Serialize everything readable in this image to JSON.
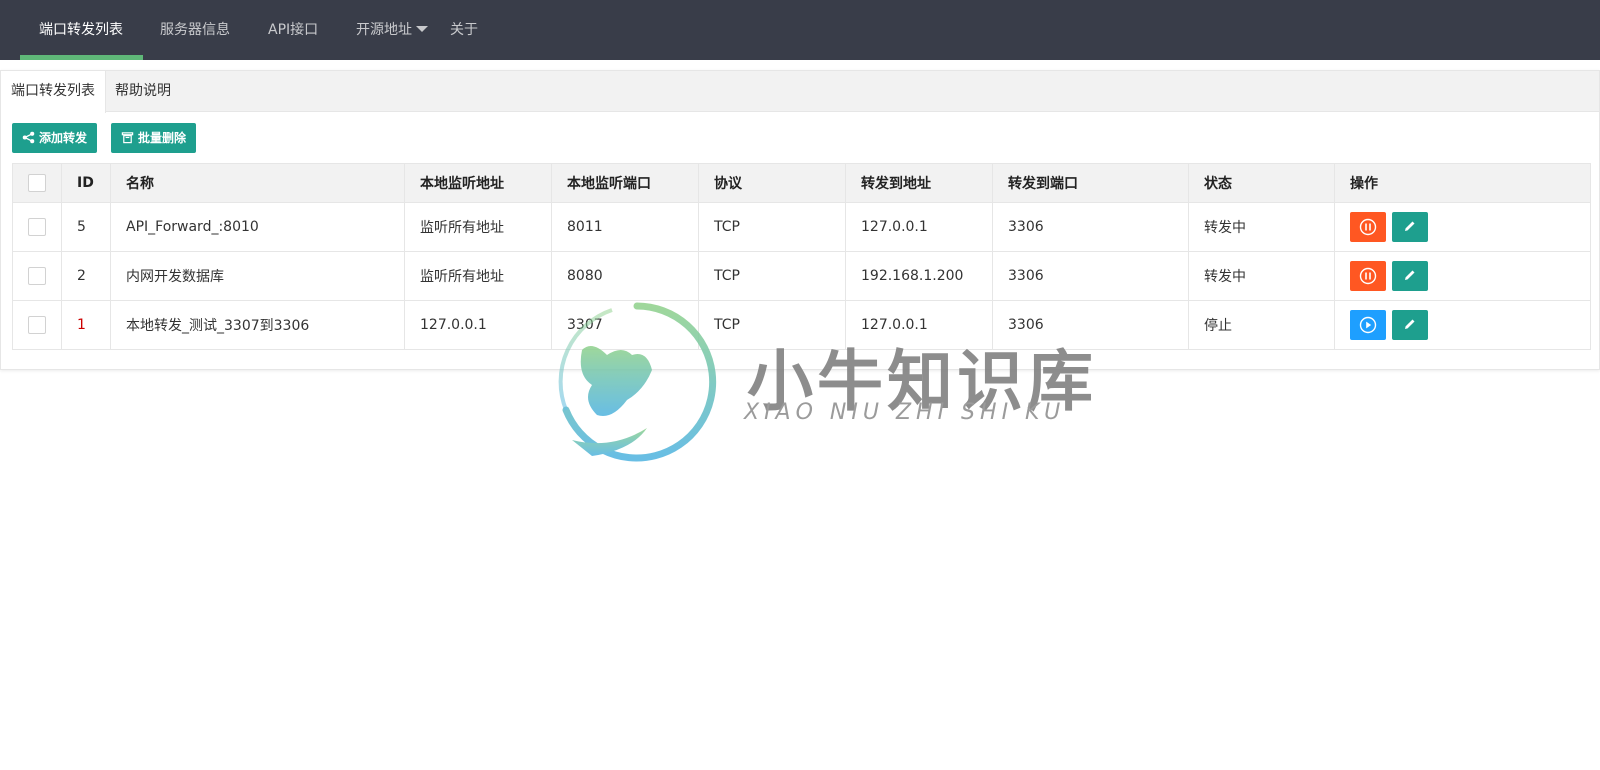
{
  "nav": {
    "items": [
      {
        "label": "端口转发列表",
        "active": true
      },
      {
        "label": "服务器信息"
      },
      {
        "label": "API接口"
      },
      {
        "label": "开源地址"
      },
      {
        "label": "关于"
      }
    ]
  },
  "tabs": [
    {
      "label": "端口转发列表",
      "active": true
    },
    {
      "label": "帮助说明"
    }
  ],
  "toolbar": {
    "add_label": "添加转发",
    "batch_delete_label": "批量删除"
  },
  "table": {
    "headers": [
      "",
      "ID",
      "名称",
      "本地监听地址",
      "本地监听端口",
      "协议",
      "转发到地址",
      "转发到端口",
      "状态",
      "操作"
    ],
    "rows": [
      {
        "id": "5",
        "name": "API_Forward_:8010",
        "listen_addr": "监听所有地址",
        "listen_port": "8011",
        "protocol": "TCP",
        "target_addr": "127.0.0.1",
        "target_port": "3306",
        "status": "转发中",
        "status_color": "#2ba84a",
        "action": "pause"
      },
      {
        "id": "2",
        "name": "内网开发数据库",
        "listen_addr": "监听所有地址",
        "listen_port": "8080",
        "protocol": "TCP",
        "target_addr": "192.168.1.200",
        "target_port": "3306",
        "status": "转发中",
        "status_color": "#2ba84a",
        "action": "pause"
      },
      {
        "id": "1",
        "name": "本地转发_测试_3307到3306",
        "listen_addr": "127.0.0.1",
        "listen_port": "3307",
        "protocol": "TCP",
        "target_addr": "127.0.0.1",
        "target_port": "3306",
        "status": "停止",
        "status_color": "#e8382f",
        "action": "play"
      }
    ]
  },
  "watermark": {
    "cn": "小牛知识库",
    "en": "XIAO NIU ZHI SHI KU"
  },
  "colors": {
    "nav_bg": "#393d49",
    "nav_active_bar": "#5fb878",
    "primary": "#1e9f8e",
    "warn": "#ff5722",
    "info": "#1e9fff"
  }
}
